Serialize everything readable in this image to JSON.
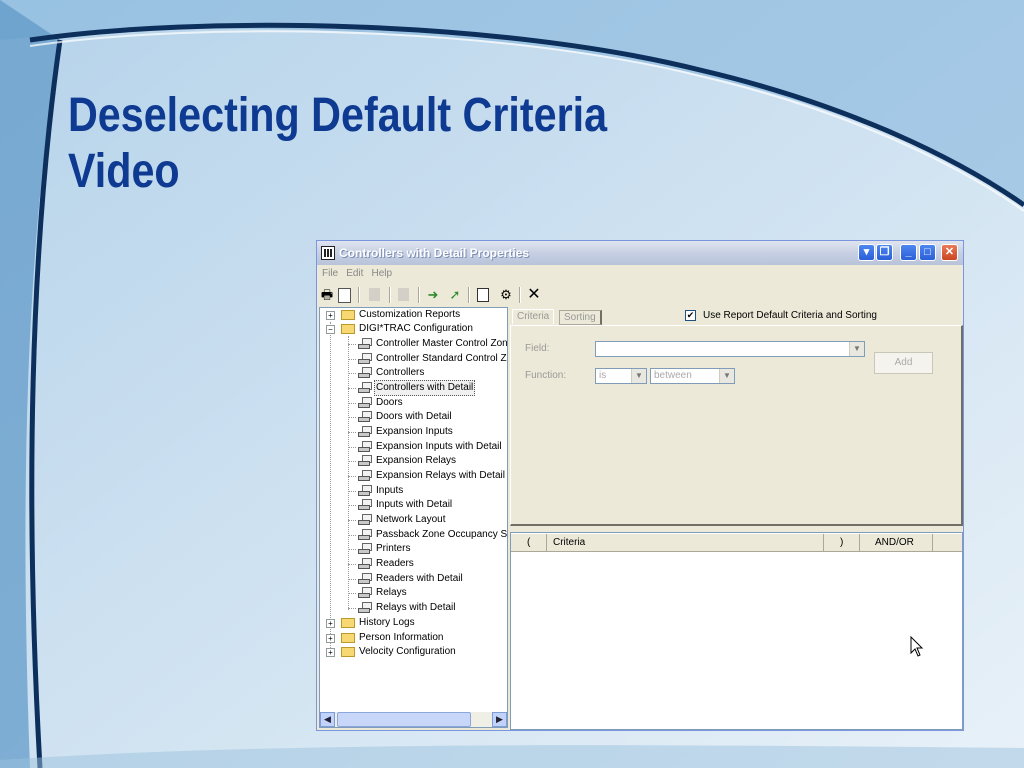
{
  "slide": {
    "title_line1": "Deselecting Default Criteria",
    "title_line2": "Video"
  },
  "window": {
    "title": "Controllers with Detail Properties",
    "menu": [
      "File",
      "Edit",
      "Help"
    ]
  },
  "tree": {
    "nodes": [
      {
        "label": "Customization Reports",
        "type": "folder",
        "level": 0,
        "expander": "+"
      },
      {
        "label": "DIGI*TRAC Configuration",
        "type": "folder",
        "level": 0,
        "expander": "-"
      },
      {
        "label": "Controller Master Control Zone",
        "type": "report",
        "level": 1
      },
      {
        "label": "Controller Standard Control Zc",
        "type": "report",
        "level": 1
      },
      {
        "label": "Controllers",
        "type": "report",
        "level": 1
      },
      {
        "label": "Controllers with Detail",
        "type": "report",
        "level": 1,
        "selected": true
      },
      {
        "label": "Doors",
        "type": "report",
        "level": 1
      },
      {
        "label": "Doors with Detail",
        "type": "report",
        "level": 1
      },
      {
        "label": "Expansion Inputs",
        "type": "report",
        "level": 1
      },
      {
        "label": "Expansion Inputs with Detail",
        "type": "report",
        "level": 1
      },
      {
        "label": "Expansion Relays",
        "type": "report",
        "level": 1
      },
      {
        "label": "Expansion Relays with Detail",
        "type": "report",
        "level": 1
      },
      {
        "label": "Inputs",
        "type": "report",
        "level": 1
      },
      {
        "label": "Inputs with Detail",
        "type": "report",
        "level": 1
      },
      {
        "label": "Network Layout",
        "type": "report",
        "level": 1
      },
      {
        "label": "Passback Zone Occupancy S",
        "type": "report",
        "level": 1
      },
      {
        "label": "Printers",
        "type": "report",
        "level": 1
      },
      {
        "label": "Readers",
        "type": "report",
        "level": 1
      },
      {
        "label": "Readers with Detail",
        "type": "report",
        "level": 1
      },
      {
        "label": "Relays",
        "type": "report",
        "level": 1
      },
      {
        "label": "Relays with Detail",
        "type": "report",
        "level": 1
      },
      {
        "label": "History Logs",
        "type": "folder",
        "level": 0,
        "expander": "+"
      },
      {
        "label": "Person Information",
        "type": "folder",
        "level": 0,
        "expander": "+"
      },
      {
        "label": "Velocity Configuration",
        "type": "folder",
        "level": 0,
        "expander": "+"
      }
    ]
  },
  "tabs": {
    "criteria": "Criteria",
    "sorting": "Sorting"
  },
  "default_checkbox": {
    "label": "Use Report Default Criteria and Sorting",
    "checked": true
  },
  "criteria_form": {
    "field_label": "Field:",
    "field_value": "",
    "add_button": "Add",
    "function_label": "Function:",
    "function_value": "is",
    "operator_value": "between"
  },
  "criteria_grid": {
    "columns": [
      "(",
      "Criteria",
      ")",
      "AND/OR"
    ]
  },
  "icons": {
    "toolbar": [
      "print-icon",
      "print-preview-icon",
      "disabled-doc-icon",
      "disabled-doc-icon",
      "run-report-icon",
      "run-report-alt-icon",
      "new-doc-icon",
      "properties-icon",
      "close-x-icon"
    ]
  }
}
